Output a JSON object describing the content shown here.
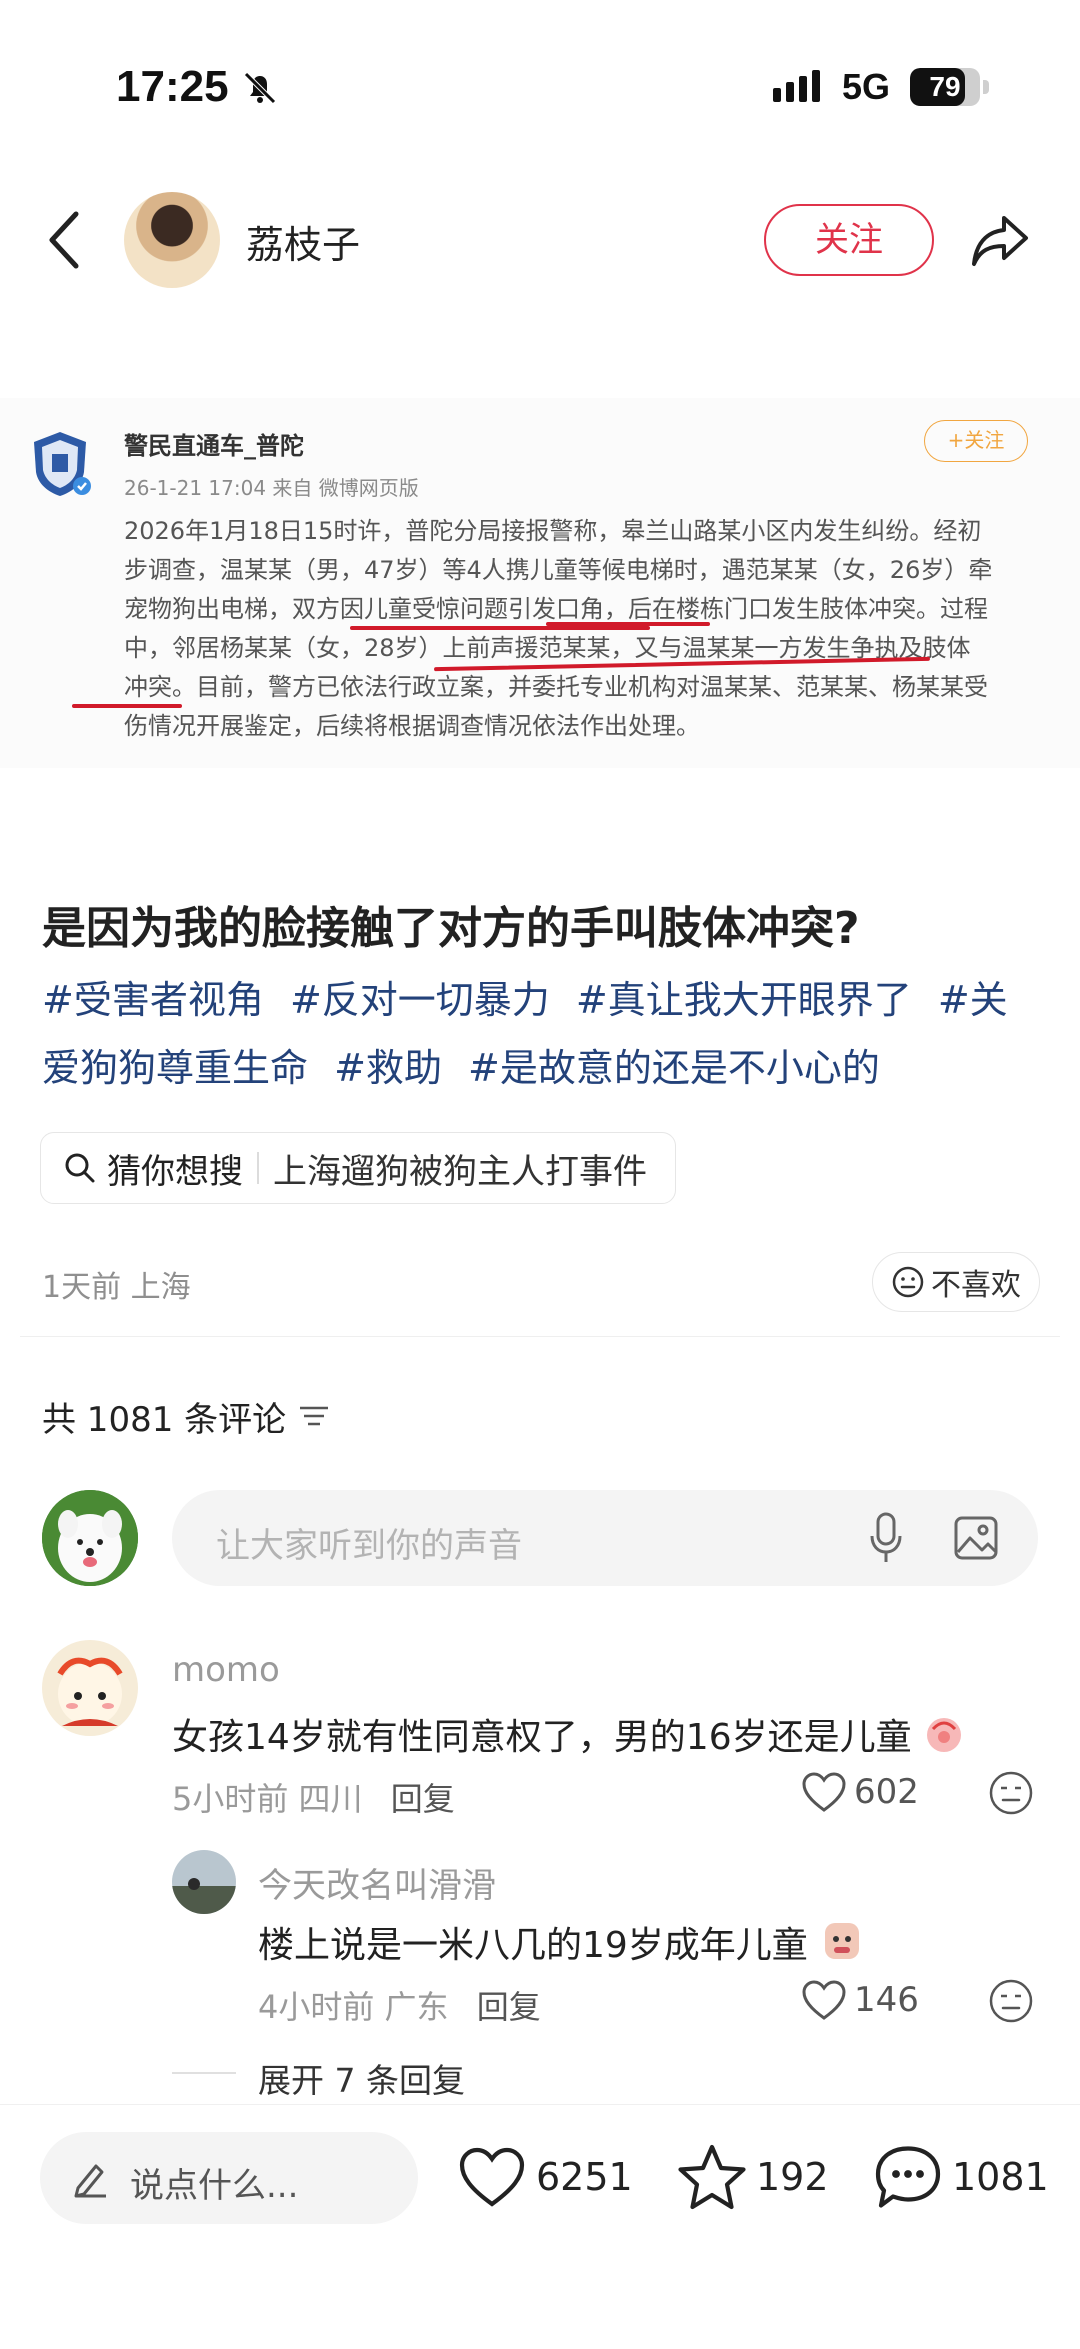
{
  "status_bar": {
    "time": "17:25",
    "network": "5G",
    "battery": "79",
    "battery_level": 0.79
  },
  "header": {
    "author": "荔枝子",
    "follow_label": "关注"
  },
  "embedded_post": {
    "account": "警民直通车_普陀",
    "meta": "26-1-21 17:04  来自 微博网页版",
    "follow_label": "+关注",
    "lines": [
      "2026年1月18日15时许，普陀分局接报警称，皋兰山路某小区内发生纠纷。经初",
      "步调查，温某某（男，47岁）等4人携儿童等候电梯时，遇范某某（女，26岁）牵",
      "宠物狗出电梯，双方因儿童受惊问题引发口角，后在楼栋门口发生肢体冲突。过程",
      "中，邻居杨某某（女，28岁）上前声援范某某，又与温某某一方发生争执及肢体",
      "冲突。目前，警方已依法行政立案，并委托专业机构对温某某、范某某、杨某某受",
      "伤情况开展鉴定，后续将根据调查情况依法作出处理。"
    ]
  },
  "post": {
    "title": "是因为我的脸接触了对方的手叫肢体冲突?",
    "tags": [
      "#受害者视角",
      "#反对一切暴力",
      "#真让我大开眼界了",
      "#关爱狗狗尊重生命",
      "#救助",
      "#是故意的还是不小心的"
    ],
    "search_prefix": "猜你想搜",
    "search_query": "上海遛狗被狗主人打事件",
    "time_location": "1天前 上海",
    "dislike_label": "不喜欢"
  },
  "comments_section": {
    "count_label": "共 1081 条评论",
    "input_placeholder": "让大家听到你的声音",
    "comments": [
      {
        "user": "momo",
        "text": "女孩14岁就有性同意权了，男的16岁还是儿童",
        "time_location": "5小时前 四川",
        "reply_label": "回复",
        "likes": "602"
      },
      {
        "user": "今天改名叫滑滑",
        "text": "楼上说是一米八几的19岁成年儿童",
        "time_location": "4小时前 广东",
        "reply_label": "回复",
        "likes": "146"
      }
    ],
    "expand_label": "展开 7 条回复"
  },
  "bottom_bar": {
    "placeholder": "说点什么...",
    "likes": "6251",
    "stars": "192",
    "comments": "1081"
  },
  "colors": {
    "accent": "#e0334a",
    "tag": "#23427a",
    "underline": "#d11a2a",
    "weibo_follow": "#f1a640"
  }
}
